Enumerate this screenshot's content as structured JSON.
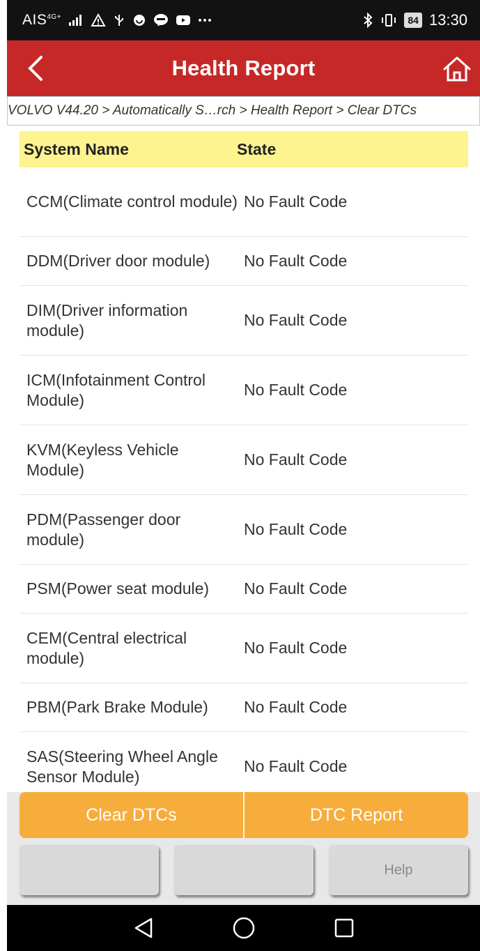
{
  "status_bar": {
    "carrier": "AIS",
    "network": "4G+",
    "battery": "84",
    "time": "13:30"
  },
  "app_bar": {
    "title": "Health Report",
    "back_icon": "chevron-left-icon",
    "home_icon": "home-icon"
  },
  "breadcrumb": {
    "text": "VOLVO V44.20 > Automatically S…rch > Health Report > Clear DTCs"
  },
  "table": {
    "headers": {
      "name": "System Name",
      "state": "State"
    },
    "rows": [
      {
        "name": "CCM(Climate control module)",
        "state": "No Fault Code"
      },
      {
        "name": "DDM(Driver door module)",
        "state": "No Fault Code"
      },
      {
        "name": "DIM(Driver information module)",
        "state": "No Fault Code"
      },
      {
        "name": "ICM(Infotainment Control Module)",
        "state": "No Fault Code"
      },
      {
        "name": "KVM(Keyless Vehicle Module)",
        "state": "No Fault Code"
      },
      {
        "name": "PDM(Passenger door module)",
        "state": "No Fault Code"
      },
      {
        "name": "PSM(Power seat module)",
        "state": "No Fault Code"
      },
      {
        "name": "CEM(Central electrical module)",
        "state": "No Fault Code"
      },
      {
        "name": "PBM(Park Brake Module)",
        "state": "No Fault Code"
      },
      {
        "name": "SAS(Steering Wheel Angle Sensor Module)",
        "state": "No Fault Code"
      }
    ]
  },
  "actions": {
    "clear_dtcs": "Clear DTCs",
    "dtc_report": "DTC Report",
    "blank_1": "",
    "blank_2": "",
    "help": "Help"
  },
  "colors": {
    "app_bar": "#c62828",
    "header_row": "#fdf38f",
    "orange_button": "#f7ad3c"
  }
}
